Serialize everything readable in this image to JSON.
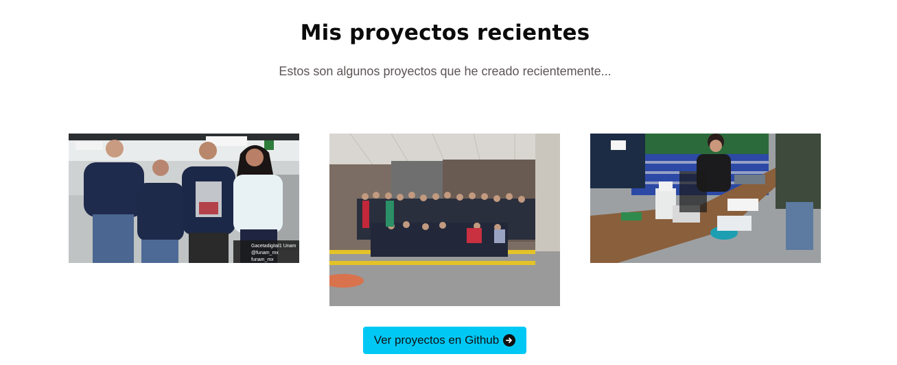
{
  "section": {
    "title": "Mis proyectos recientes",
    "subtitle": "Estos son algunos proyectos que he creado recientemente..."
  },
  "projects": [
    {
      "image_text": {
        "handle_1": "Gacetadigital1 Unam",
        "handle_2": "@funam_mx",
        "handle_3": "funam_mx"
      }
    },
    {},
    {}
  ],
  "cta": {
    "label": "Ver proyectos en Github",
    "icon": "arrow-right-circle-icon"
  },
  "colors": {
    "accent": "#00c8f5",
    "title": "#0b0b0b",
    "subtitle": "#5c5454"
  }
}
